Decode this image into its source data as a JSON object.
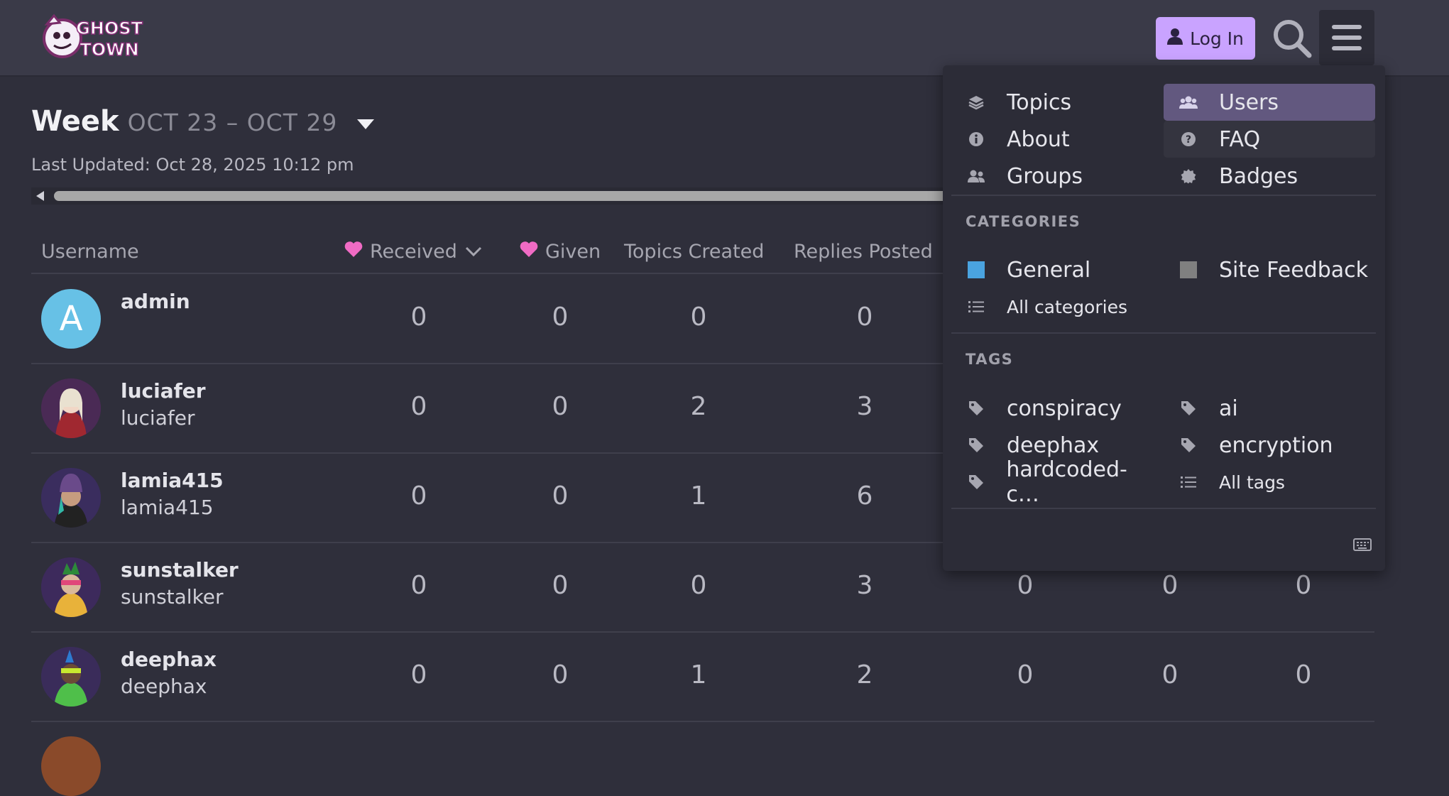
{
  "header": {
    "logo_text_1": "GHOST",
    "logo_text_2": "TOWN",
    "login_label": "Log In",
    "icons": {
      "search": "search-icon",
      "menu": "hamburger-menu-icon",
      "user": "user-icon"
    }
  },
  "period": {
    "title": "Week",
    "range": "OCT 23 – OCT 29",
    "last_updated": "Last Updated: Oct 28, 2025 10:12 pm"
  },
  "table": {
    "columns": [
      "Username",
      "Received",
      "Given",
      "Topics Created",
      "Replies Posted"
    ],
    "rows": [
      {
        "username": "admin",
        "name": "",
        "avatar_letter": "A",
        "values": [
          "0",
          "0",
          "0",
          "0"
        ]
      },
      {
        "username": "luciafer",
        "name": "luciafer",
        "values": [
          "0",
          "0",
          "2",
          "3"
        ]
      },
      {
        "username": "lamia415",
        "name": "lamia415",
        "values": [
          "0",
          "0",
          "1",
          "6"
        ]
      },
      {
        "username": "sunstalker",
        "name": "sunstalker",
        "values": [
          "0",
          "0",
          "0",
          "3",
          "0",
          "0",
          "0"
        ]
      },
      {
        "username": "deephax",
        "name": "deephax",
        "values": [
          "0",
          "0",
          "1",
          "2",
          "0",
          "0",
          "0"
        ]
      }
    ]
  },
  "menu": {
    "links": [
      {
        "label": "Topics",
        "icon": "layers-icon"
      },
      {
        "label": "Users",
        "icon": "users-icon"
      },
      {
        "label": "About",
        "icon": "info-icon"
      },
      {
        "label": "FAQ",
        "icon": "question-icon"
      },
      {
        "label": "Groups",
        "icon": "groups-icon"
      },
      {
        "label": "Badges",
        "icon": "badge-icon"
      }
    ],
    "categories_heading": "CATEGORIES",
    "categories": [
      {
        "label": "General",
        "color": "#4aa3df"
      },
      {
        "label": "Site Feedback",
        "color": "#808080"
      }
    ],
    "all_categories": "All categories",
    "tags_heading": "TAGS",
    "tags": [
      "conspiracy",
      "ai",
      "deephax",
      "encryption",
      "hardcoded-c…"
    ],
    "all_tags": "All tags"
  },
  "colors": {
    "accent": "#c9a3ff",
    "heart": "#f06bc4",
    "active_menu": "#62587f",
    "background": "#2f2f3b"
  }
}
